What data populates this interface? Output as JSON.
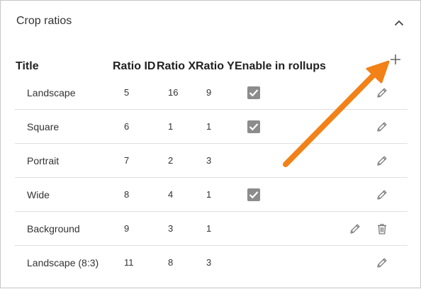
{
  "panel": {
    "title": "Crop ratios"
  },
  "table": {
    "headers": {
      "title": "Title",
      "ratio_id": "Ratio ID",
      "ratio_x": "Ratio X",
      "ratio_y": "Ratio Y",
      "enable_in_rollups": "Enable in rollups"
    },
    "rows": [
      {
        "title": "Landscape",
        "ratio_id": "5",
        "ratio_x": "16",
        "ratio_y": "9",
        "enabled": true,
        "deletable": false
      },
      {
        "title": "Square",
        "ratio_id": "6",
        "ratio_x": "1",
        "ratio_y": "1",
        "enabled": true,
        "deletable": false
      },
      {
        "title": "Portrait",
        "ratio_id": "7",
        "ratio_x": "2",
        "ratio_y": "3",
        "enabled": false,
        "deletable": false
      },
      {
        "title": "Wide",
        "ratio_id": "8",
        "ratio_x": "4",
        "ratio_y": "1",
        "enabled": true,
        "deletable": false
      },
      {
        "title": "Background",
        "ratio_id": "9",
        "ratio_x": "3",
        "ratio_y": "1",
        "enabled": false,
        "deletable": true
      },
      {
        "title": "Landscape (8:3)",
        "ratio_id": "11",
        "ratio_x": "8",
        "ratio_y": "3",
        "enabled": false,
        "deletable": false
      }
    ]
  },
  "icons": {
    "collapse": "chevron-up-icon",
    "add": "plus-icon",
    "edit": "pencil-icon",
    "delete": "trash-icon",
    "checkbox": "checkmark-icon",
    "annotation": "orange-arrow"
  },
  "colors": {
    "annotation_arrow": "#f28117",
    "checkbox": "#8c8c8c",
    "icon": "#777777"
  }
}
